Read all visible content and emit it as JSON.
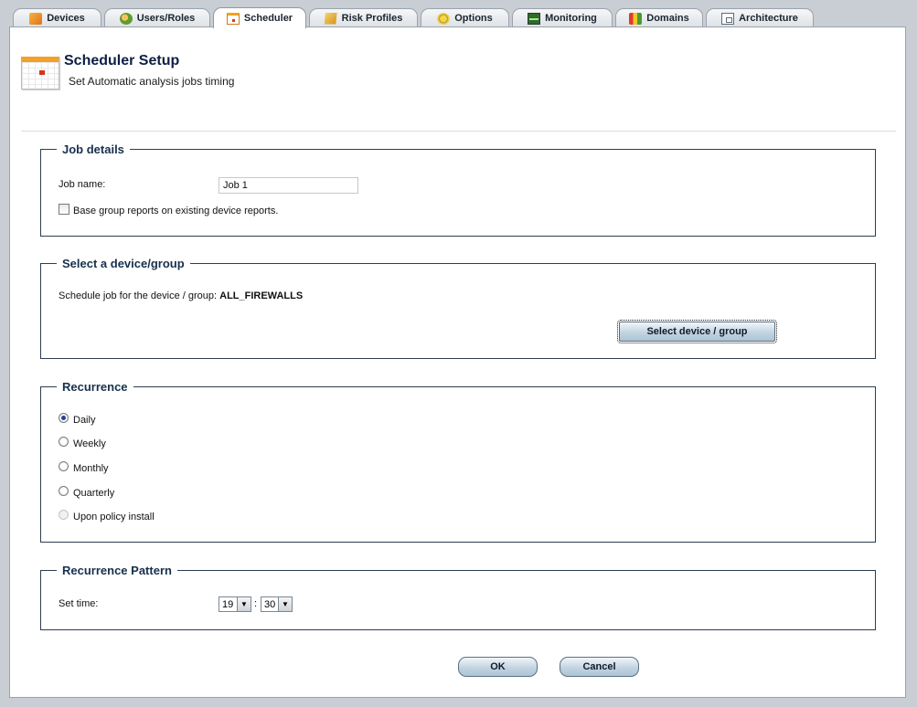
{
  "tabs": [
    {
      "label": "Devices",
      "icon": "devices-icon"
    },
    {
      "label": "Users/Roles",
      "icon": "users-icon"
    },
    {
      "label": "Scheduler",
      "icon": "scheduler-icon",
      "active": true
    },
    {
      "label": "Risk Profiles",
      "icon": "risk-profiles-icon"
    },
    {
      "label": "Options",
      "icon": "options-icon"
    },
    {
      "label": "Monitoring",
      "icon": "monitoring-icon"
    },
    {
      "label": "Domains",
      "icon": "domains-icon"
    },
    {
      "label": "Architecture",
      "icon": "architecture-icon"
    }
  ],
  "header": {
    "title": "Scheduler Setup",
    "subtitle": "Set Automatic analysis jobs timing",
    "icon": "calendar-icon"
  },
  "job_details": {
    "legend": "Job details",
    "job_name_label": "Job name:",
    "job_name_value": "Job 1",
    "base_group_label": "Base group reports on existing device reports.",
    "base_group_checked": false
  },
  "device_group": {
    "legend": "Select a device/group",
    "schedule_text": "Schedule job for the device / group:",
    "selected_value": "ALL_FIREWALLS",
    "button_label": "Select device / group"
  },
  "recurrence": {
    "legend": "Recurrence",
    "options": [
      {
        "label": "Daily",
        "checked": true,
        "disabled": false
      },
      {
        "label": "Weekly",
        "checked": false,
        "disabled": false
      },
      {
        "label": "Monthly",
        "checked": false,
        "disabled": false
      },
      {
        "label": "Quarterly",
        "checked": false,
        "disabled": false
      },
      {
        "label": "Upon policy install",
        "checked": false,
        "disabled": true
      }
    ]
  },
  "pattern": {
    "legend": "Recurrence Pattern",
    "set_time_label": "Set time:",
    "hour": "19",
    "separator": ":",
    "minute": "30"
  },
  "footer": {
    "ok_label": "OK",
    "cancel_label": "Cancel"
  },
  "colors": {
    "legend_text": "#17304e",
    "fieldset_border": "#2c3d52",
    "button_gradient_mid": "#c3d4e1",
    "page_background": "#c9ced4"
  }
}
